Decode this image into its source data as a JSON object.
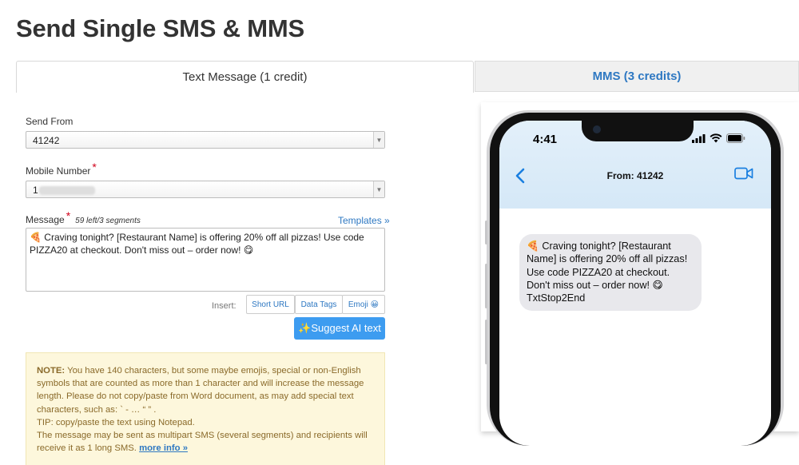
{
  "page": {
    "title": "Send Single SMS & MMS"
  },
  "tabs": {
    "text": "Text Message (1 credit)",
    "mms": "MMS (3 credits)"
  },
  "form": {
    "send_from_label": "Send From",
    "send_from_value": "41242",
    "mobile_label": "Mobile Number",
    "mobile_value_prefix": "1",
    "required_mark": "*",
    "message_label": "Message",
    "segments_info": "59 left/3 segments",
    "templates_link": "Templates »",
    "message_text": "🍕 Craving tonight? [Restaurant Name] is offering 20% off all pizzas! Use code PIZZA20 at checkout. Don't miss out – order now! 😋",
    "insert_label": "Insert:",
    "insert_buttons": [
      "Short URL",
      "Data Tags",
      "Emoji 😀"
    ],
    "ai_button": "✨Suggest AI text"
  },
  "note": {
    "heading": "NOTE:",
    "body": " You have 140 characters, but some maybe emojis, special or non-English symbols that are counted as more than 1 character and will increase the message length. Please do not copy/paste from Word document, as may add special text characters, such as: ` - … “ ” .",
    "tip": "TIP: copy/paste the text using Notepad.",
    "multipart": "The message may be sent as multipart SMS (several segments) and recipients will receive it as 1 long SMS. ",
    "more_info": "more info »"
  },
  "preview": {
    "time": "4:41",
    "contact": "From: 41242",
    "bubble_text": "🍕 Craving tonight? [Restaurant Name] is offering 20% off all pizzas! Use code PIZZA20 at checkout. Don't miss out – order now! 😋",
    "bubble_suffix": "TxtStop2End"
  },
  "colors": {
    "link": "#2e78c2",
    "ai_button": "#3d9cf0",
    "note_bg": "#fdf7dc",
    "required": "#d0021b",
    "ios_blue": "#1a7fe0"
  },
  "icons": [
    "chevron-left-icon",
    "video-camera-icon",
    "signal-icon",
    "wifi-icon",
    "battery-icon",
    "dropdown-arrow-icon"
  ]
}
